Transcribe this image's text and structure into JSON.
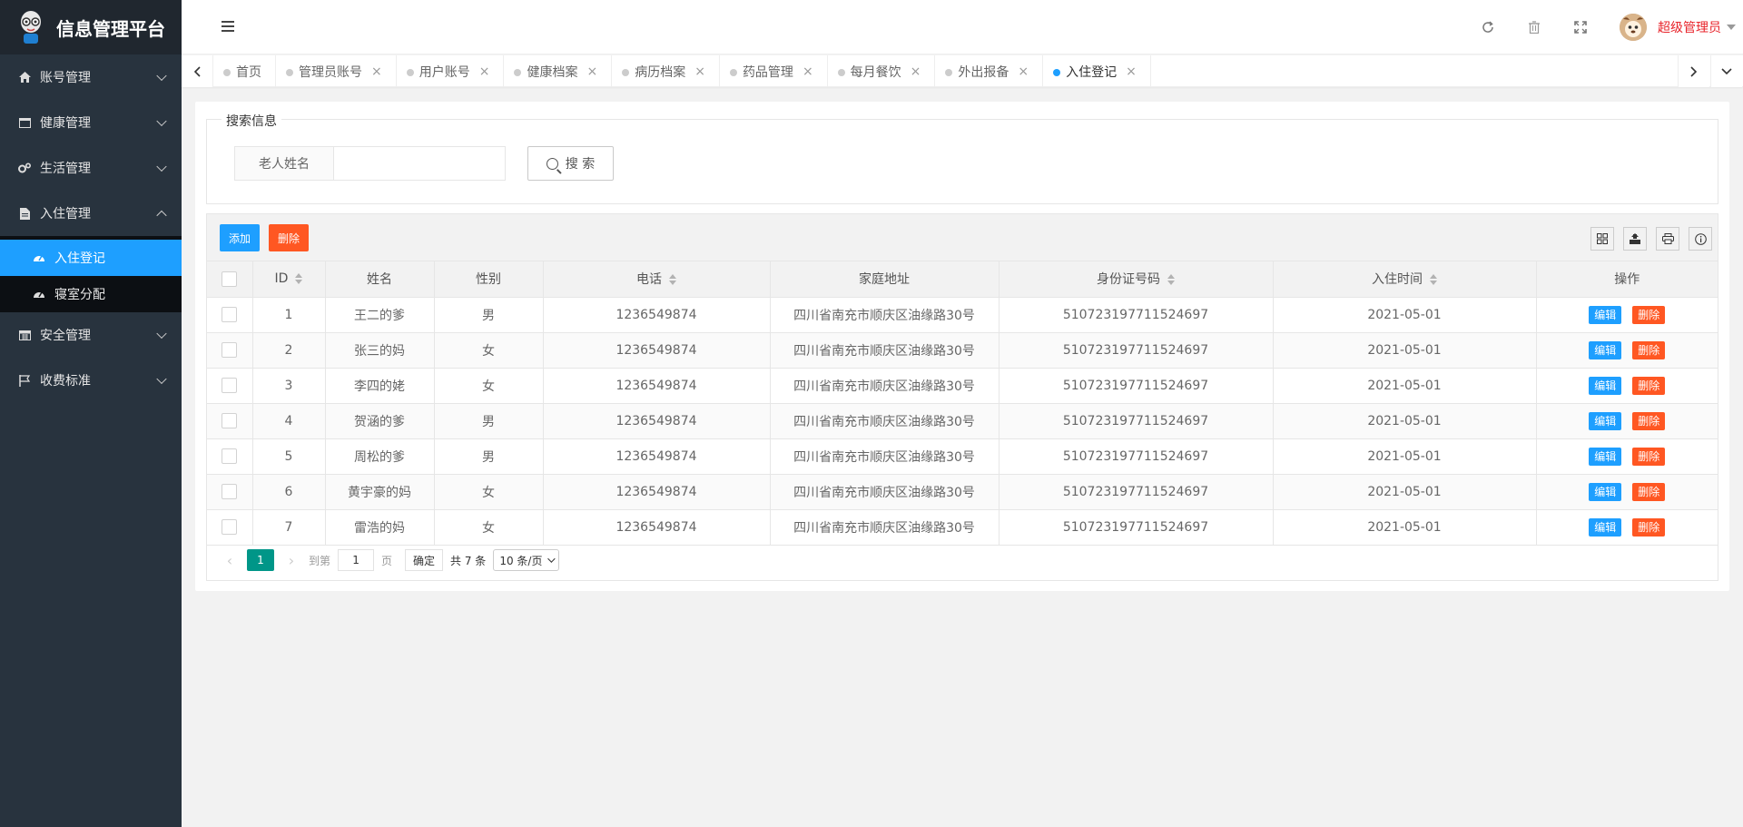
{
  "app": {
    "title": "信息管理平台"
  },
  "sidebar": {
    "items": [
      {
        "label": "账号管理",
        "icon": "home-icon"
      },
      {
        "label": "健康管理",
        "icon": "window-icon"
      },
      {
        "label": "生活管理",
        "icon": "gears-icon"
      },
      {
        "label": "入住管理",
        "icon": "file-icon",
        "expanded": true,
        "children": [
          {
            "label": "入住登记",
            "icon": "dashboard-icon",
            "active": true
          },
          {
            "label": "寝室分配",
            "icon": "dashboard-icon"
          }
        ]
      },
      {
        "label": "安全管理",
        "icon": "calendar-icon"
      },
      {
        "label": "收费标准",
        "icon": "flag-icon"
      }
    ]
  },
  "header": {
    "user": "超级管理员",
    "icons": [
      "refresh-icon",
      "trash-icon",
      "fullscreen-icon"
    ]
  },
  "tabs": [
    {
      "label": "首页",
      "closable": false,
      "active": false
    },
    {
      "label": "管理员账号",
      "closable": true,
      "active": false
    },
    {
      "label": "用户账号",
      "closable": true,
      "active": false
    },
    {
      "label": "健康档案",
      "closable": true,
      "active": false
    },
    {
      "label": "病历档案",
      "closable": true,
      "active": false
    },
    {
      "label": "药品管理",
      "closable": true,
      "active": false
    },
    {
      "label": "每月餐饮",
      "closable": true,
      "active": false
    },
    {
      "label": "外出报备",
      "closable": true,
      "active": false
    },
    {
      "label": "入住登记",
      "closable": true,
      "active": true
    }
  ],
  "search": {
    "legend": "搜索信息",
    "label": "老人姓名",
    "value": "",
    "button": "搜 索"
  },
  "toolbar": {
    "add": "添加",
    "delete": "删除"
  },
  "table": {
    "columns": [
      "ID",
      "姓名",
      "性别",
      "电话",
      "家庭地址",
      "身份证号码",
      "入住时间",
      "操作"
    ],
    "rows": [
      {
        "id": "1",
        "name": "王二的爹",
        "gender": "男",
        "phone": "1236549874",
        "address": "四川省南充市顺庆区油缘路30号",
        "idcard": "510723197711524697",
        "date": "2021-05-01"
      },
      {
        "id": "2",
        "name": "张三的妈",
        "gender": "女",
        "phone": "1236549874",
        "address": "四川省南充市顺庆区油缘路30号",
        "idcard": "510723197711524697",
        "date": "2021-05-01"
      },
      {
        "id": "3",
        "name": "李四的姥",
        "gender": "女",
        "phone": "1236549874",
        "address": "四川省南充市顺庆区油缘路30号",
        "idcard": "510723197711524697",
        "date": "2021-05-01"
      },
      {
        "id": "4",
        "name": "贺涵的爹",
        "gender": "男",
        "phone": "1236549874",
        "address": "四川省南充市顺庆区油缘路30号",
        "idcard": "510723197711524697",
        "date": "2021-05-01"
      },
      {
        "id": "5",
        "name": "周松的爹",
        "gender": "男",
        "phone": "1236549874",
        "address": "四川省南充市顺庆区油缘路30号",
        "idcard": "510723197711524697",
        "date": "2021-05-01"
      },
      {
        "id": "6",
        "name": "黄宇豪的妈",
        "gender": "女",
        "phone": "1236549874",
        "address": "四川省南充市顺庆区油缘路30号",
        "idcard": "510723197711524697",
        "date": "2021-05-01"
      },
      {
        "id": "7",
        "name": "雷浩的妈",
        "gender": "女",
        "phone": "1236549874",
        "address": "四川省南充市顺庆区油缘路30号",
        "idcard": "510723197711524697",
        "date": "2021-05-01"
      }
    ],
    "actions": {
      "edit": "编辑",
      "delete": "删除"
    }
  },
  "pager": {
    "current": "1",
    "goto_label": "到第",
    "goto_value": "1",
    "page_label": "页",
    "confirm": "确定",
    "total": "共 7 条",
    "page_size": "10 条/页"
  },
  "colors": {
    "primary": "#1e9fff",
    "danger": "#ff5722",
    "pager_active": "#009688",
    "sidebar_bg": "#28333e",
    "user_text": "#e8242b"
  }
}
